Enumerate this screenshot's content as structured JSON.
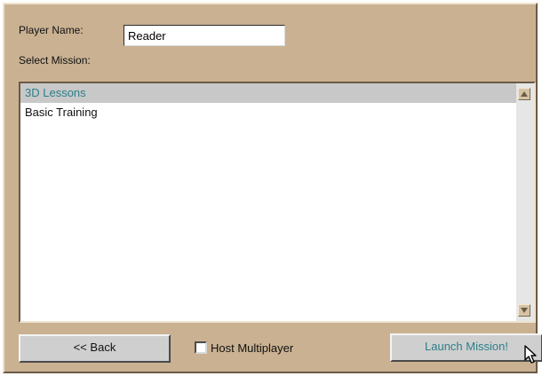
{
  "form": {
    "player_name_label": "Player Name:",
    "player_name_value": "Reader",
    "select_mission_label": "Select Mission:"
  },
  "missions": [
    {
      "label": "3D Lessons",
      "selected": true
    },
    {
      "label": "Basic Training",
      "selected": false
    }
  ],
  "footer": {
    "back_label": "<< Back",
    "host_multiplayer_label": "Host Multiplayer",
    "host_multiplayer_checked": false,
    "launch_label": "Launch Mission!"
  },
  "colors": {
    "panel_bg": "#c9b192",
    "selected_row_bg": "#c8c8c8",
    "accent_text": "#2d7f8a"
  },
  "icons": {
    "scroll_up": "arrow-up-icon",
    "scroll_down": "arrow-down-icon",
    "cursor": "mouse-pointer-icon"
  }
}
